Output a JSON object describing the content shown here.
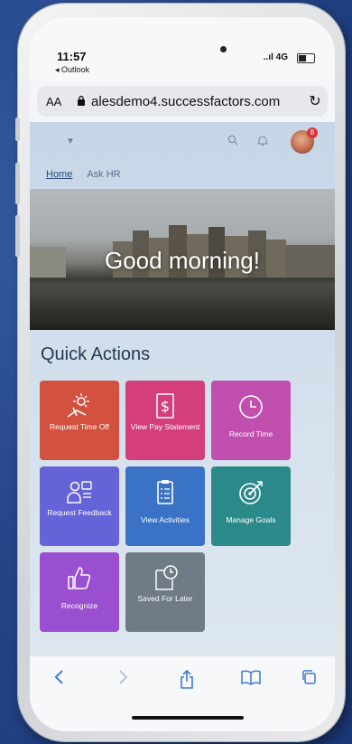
{
  "status": {
    "time": "11:57",
    "back_app": "◂ Outlook",
    "signal": "..ıl 4G"
  },
  "browser": {
    "text_size_label": "AA",
    "url": "alesdemo4.successfactors.com",
    "toolbar": [
      "back-icon",
      "forward-icon",
      "share-icon",
      "bookmarks-icon",
      "tabs-icon"
    ]
  },
  "app": {
    "badge": "8",
    "nav": {
      "home": "Home",
      "ask_hr": "Ask HR"
    },
    "greeting": "Good morning!",
    "quick_actions_title": "Quick Actions",
    "tiles": [
      {
        "label": "Request Time Off",
        "icon": "sun-beach-icon",
        "color": "#d2513f"
      },
      {
        "label": "View Pay Statement",
        "icon": "dollar-document-icon",
        "color": "#d33e7b"
      },
      {
        "label": "Record Time",
        "icon": "clock-icon",
        "color": "#c04fae"
      },
      {
        "label": "Request Feedback",
        "icon": "people-feedback-icon",
        "color": "#6563d8"
      },
      {
        "label": "View Activities",
        "icon": "clipboard-icon",
        "color": "#3a73c6"
      },
      {
        "label": "Manage Goals",
        "icon": "target-icon",
        "color": "#2b8a89"
      },
      {
        "label": "Recognize",
        "icon": "thumbs-up-icon",
        "color": "#9a4ed0"
      },
      {
        "label": "Saved For Later",
        "icon": "saved-clock-icon",
        "color": "#6f7c86"
      }
    ]
  }
}
